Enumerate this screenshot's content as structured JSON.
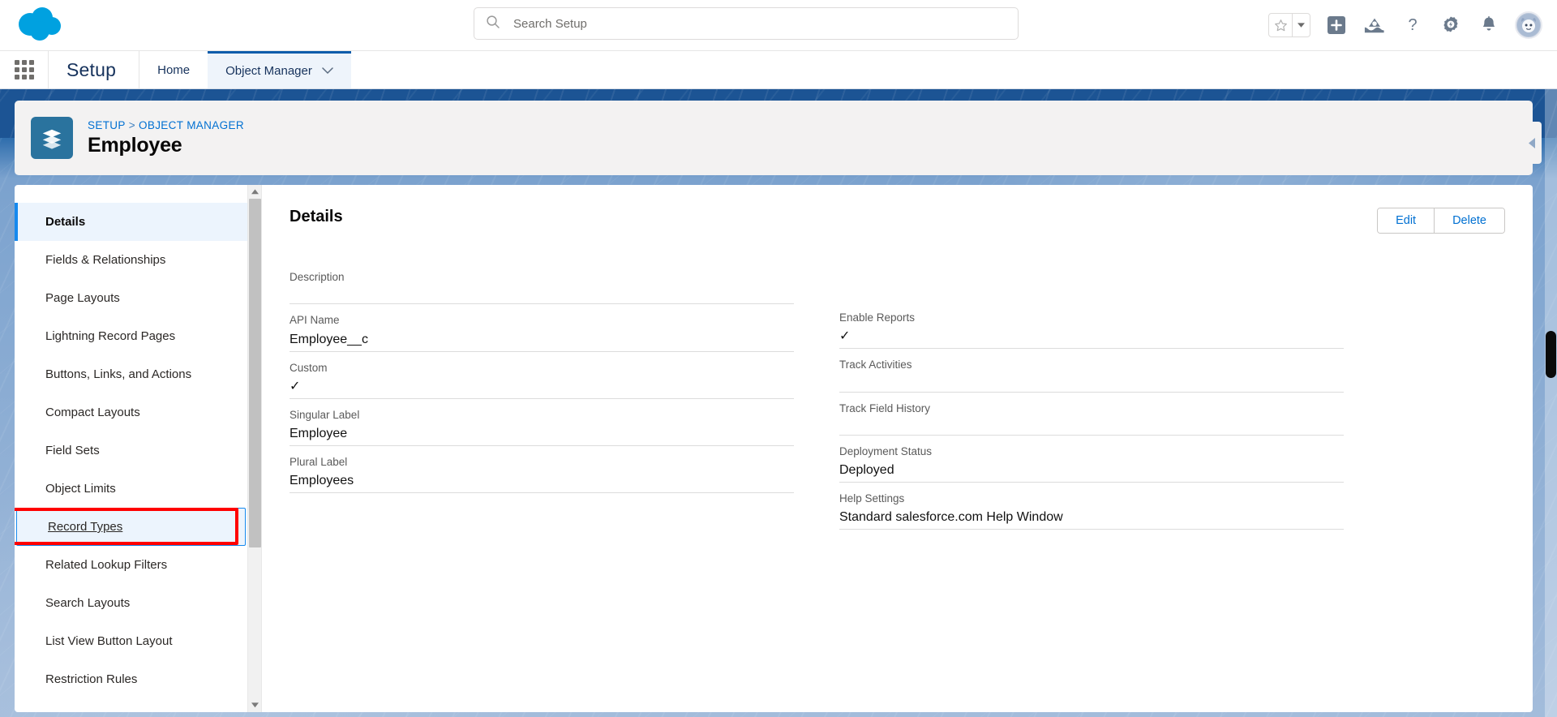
{
  "header": {
    "logo_icon": "salesforce-cloud-logo",
    "search": {
      "placeholder": "Search Setup",
      "value": "",
      "icon": "search-icon"
    },
    "icons": [
      {
        "name": "favorites-star-icon",
        "glyph": "star"
      },
      {
        "name": "favorites-dropdown-icon",
        "glyph": "caret-down"
      },
      {
        "name": "global-actions-plus-icon",
        "glyph": "plus-square"
      },
      {
        "name": "trailhead-icon",
        "glyph": "mountain"
      },
      {
        "name": "help-icon",
        "glyph": "question-mark"
      },
      {
        "name": "setup-gear-icon",
        "glyph": "gear-lightning"
      },
      {
        "name": "notifications-bell-icon",
        "glyph": "bell"
      },
      {
        "name": "user-avatar",
        "glyph": "astro-avatar"
      }
    ]
  },
  "setup_bar": {
    "app_launcher_icon": "app-launcher-waffle-icon",
    "title": "Setup",
    "tabs": [
      {
        "label": "Home",
        "active": false,
        "has_chevron": false
      },
      {
        "label": "Object Manager",
        "active": true,
        "has_chevron": true
      }
    ]
  },
  "record_header": {
    "object_icon": "custom-object-stack-icon",
    "breadcrumb": {
      "first": "SETUP",
      "separator": ">",
      "second": "OBJECT MANAGER"
    },
    "title": "Employee",
    "collapse_icon": "collapse-left-arrow-icon"
  },
  "sidebar": {
    "items": [
      {
        "label": "Details",
        "state": "active"
      },
      {
        "label": "Fields & Relationships",
        "state": "normal"
      },
      {
        "label": "Page Layouts",
        "state": "normal"
      },
      {
        "label": "Lightning Record Pages",
        "state": "normal"
      },
      {
        "label": "Buttons, Links, and Actions",
        "state": "normal"
      },
      {
        "label": "Compact Layouts",
        "state": "normal"
      },
      {
        "label": "Field Sets",
        "state": "normal"
      },
      {
        "label": "Object Limits",
        "state": "normal"
      },
      {
        "label": "Record Types",
        "state": "focused"
      },
      {
        "label": "Related Lookup Filters",
        "state": "normal"
      },
      {
        "label": "Search Layouts",
        "state": "normal"
      },
      {
        "label": "List View Button Layout",
        "state": "normal"
      },
      {
        "label": "Restriction Rules",
        "state": "normal"
      }
    ],
    "scrollbar": {
      "up_icon": "scroll-up-arrow-icon",
      "down_icon": "scroll-down-arrow-icon"
    }
  },
  "annotation": {
    "target": "Record Types",
    "color": "#ff0000"
  },
  "detail": {
    "title": "Details",
    "buttons": [
      {
        "label": "Edit"
      },
      {
        "label": "Delete"
      }
    ],
    "left_fields": [
      {
        "label": "Description",
        "value": "",
        "type": "text"
      },
      {
        "label": "API Name",
        "value": "Employee__c",
        "type": "text"
      },
      {
        "label": "Custom",
        "value": "✓",
        "type": "check"
      },
      {
        "label": "Singular Label",
        "value": "Employee",
        "type": "text"
      },
      {
        "label": "Plural Label",
        "value": "Employees",
        "type": "text"
      }
    ],
    "right_fields": [
      {
        "label": "Enable Reports",
        "value": "✓",
        "type": "check"
      },
      {
        "label": "Track Activities",
        "value": "",
        "type": "text"
      },
      {
        "label": "Track Field History",
        "value": "",
        "type": "text"
      },
      {
        "label": "Deployment Status",
        "value": "Deployed",
        "type": "text"
      },
      {
        "label": "Help Settings",
        "value": "Standard salesforce.com Help Window",
        "type": "text"
      }
    ]
  },
  "colors": {
    "brand_blue": "#0070d2",
    "active_tab_border": "#0b5cab",
    "nav_active_bar": "#1589ee",
    "object_icon_bg": "#2a739e",
    "annotation_red": "#ff0000",
    "canvas_blue": "#1c5494"
  }
}
